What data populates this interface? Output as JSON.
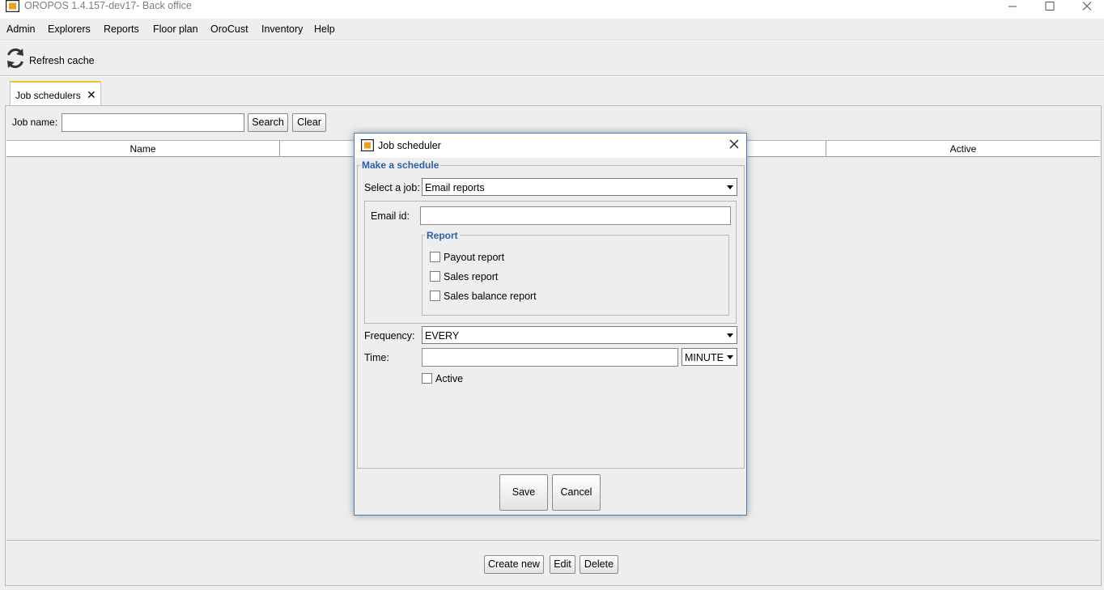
{
  "window": {
    "title": "OROPOS 1.4.157-dev17- Back office",
    "controls": [
      "minimize-icon",
      "maximize-icon",
      "close-icon"
    ]
  },
  "menubar": {
    "items": [
      {
        "label": "Admin"
      },
      {
        "label": "Explorers"
      },
      {
        "label": "Reports"
      },
      {
        "label": "Floor plan"
      },
      {
        "label": "OroCust"
      },
      {
        "label": "Inventory"
      },
      {
        "label": "Help"
      }
    ]
  },
  "toolbar": {
    "refresh_label": "Refresh cache",
    "refresh_icon": "refresh-icon"
  },
  "tabs": [
    {
      "label": "Job schedulers",
      "close": "✕"
    }
  ],
  "job_schedulers": {
    "job_name_label": "Job name:",
    "job_name_value": "",
    "search_label": "Search",
    "clear_label": "Clear",
    "columns": [
      "Name",
      "",
      "",
      "Active"
    ],
    "rows": [],
    "create_label": "Create new",
    "edit_label": "Edit",
    "delete_label": "Delete"
  },
  "dialog": {
    "title": "Job scheduler",
    "close": "close-icon",
    "group_title": "Make a schedule",
    "select_job_label": "Select a job:",
    "select_job_value": "Email reports",
    "email_label": "Email id:",
    "email_value": "",
    "report_group_title": "Report",
    "reports": [
      {
        "label": "Payout report",
        "checked": false
      },
      {
        "label": "Sales report",
        "checked": false
      },
      {
        "label": "Sales balance report",
        "checked": false
      }
    ],
    "frequency_label": "Frequency:",
    "frequency_value": "EVERY",
    "time_label": "Time:",
    "time_value": "",
    "time_unit": "MINUTE",
    "active_label": "Active",
    "active_checked": false,
    "save_label": "Save",
    "cancel_label": "Cancel"
  },
  "colors": {
    "accent_tab": "#f1c232",
    "group_title": "#2b5fa6",
    "dialog_border": "#3d7fbf",
    "window_bg": "#eeeeee"
  }
}
